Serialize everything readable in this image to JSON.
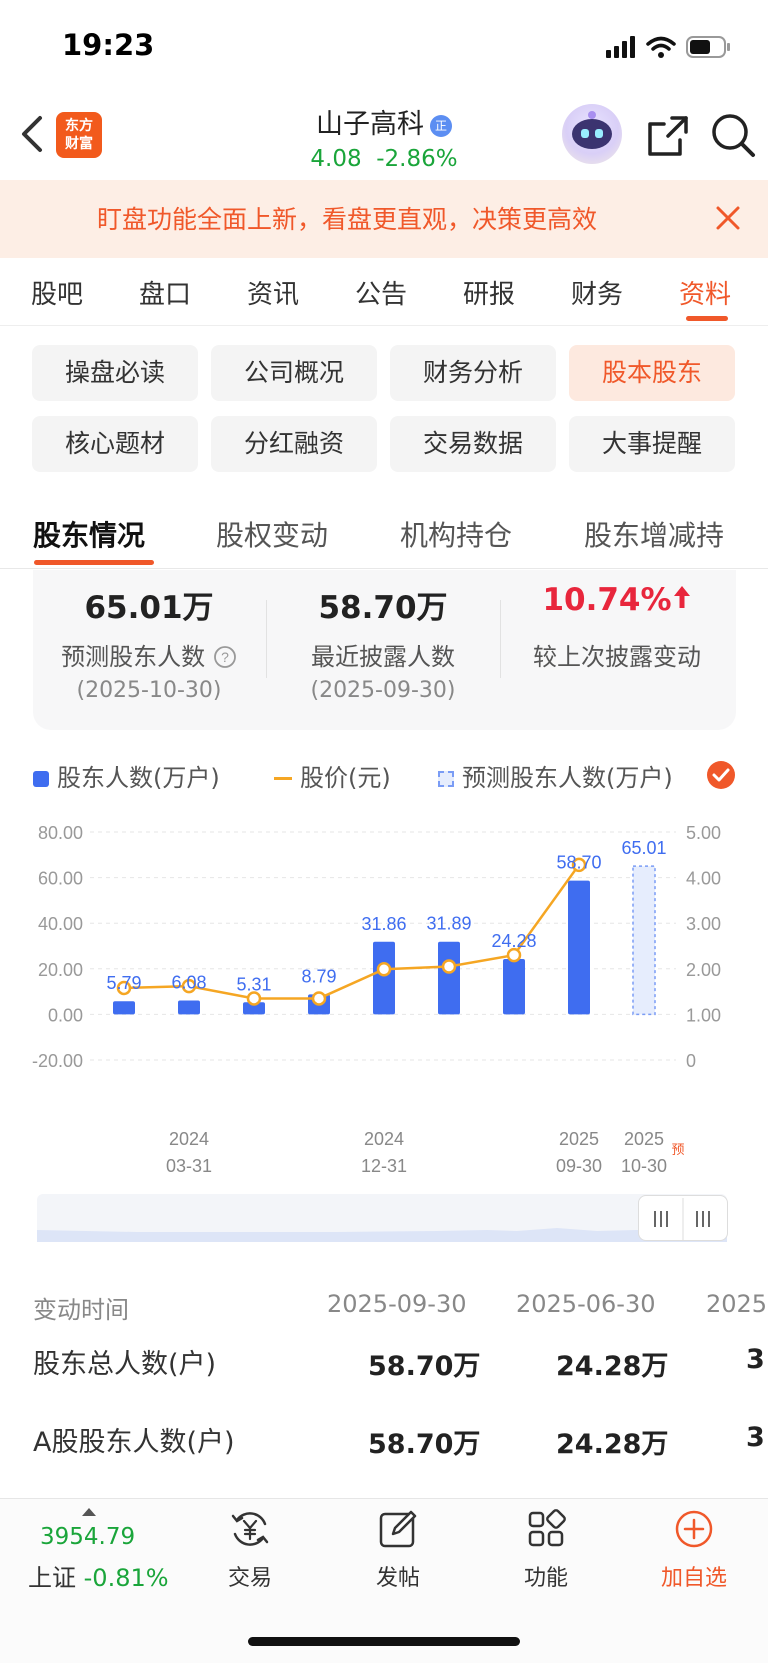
{
  "status_bar": {
    "time": "19:23"
  },
  "header": {
    "logo_line1": "东方",
    "logo_line2": "财富",
    "stock_name": "山子高科",
    "badge": "正",
    "price": "4.08",
    "change": "-2.86%"
  },
  "banner": {
    "text": "盯盘功能全面上新，看盘更直观，决策更高效"
  },
  "tabs": [
    "股吧",
    "盘口",
    "资讯",
    "公告",
    "研报",
    "财务",
    "资料"
  ],
  "sub_grid": [
    "操盘必读",
    "公司概况",
    "财务分析",
    "股本股东",
    "核心题材",
    "分红融资",
    "交易数据",
    "大事提醒"
  ],
  "section_tabs": [
    "股东情况",
    "股权变动",
    "机构持仓",
    "股东增减持"
  ],
  "stats": [
    {
      "value": "65.01万",
      "label": "预测股东人数",
      "date": "(2025-10-30)"
    },
    {
      "value": "58.70万",
      "label": "最近披露人数",
      "date": "(2025-09-30)"
    },
    {
      "value": "10.74%",
      "label": "较上次披露变动"
    }
  ],
  "legend": {
    "holders": "股东人数(万户)",
    "price": "股价(元)",
    "forecast": "预测股东人数(万户)"
  },
  "colors": {
    "accent": "#f0582a",
    "down": "#1aa53a",
    "up": "#e8263c",
    "bar": "#3f6df0",
    "line": "#f5a623"
  },
  "chart_data": {
    "type": "bar",
    "left_axis": {
      "ticks": [
        "80.00",
        "60.00",
        "40.00",
        "20.00",
        "0.00",
        "-20.00"
      ],
      "range": [
        -20,
        80
      ]
    },
    "right_axis": {
      "ticks": [
        "5.00",
        "4.00",
        "3.00",
        "2.00",
        "1.00",
        "0"
      ],
      "range": [
        0,
        5
      ]
    },
    "bars": [
      {
        "value": 5.79,
        "label": "5.79"
      },
      {
        "value": 6.08,
        "label": "6.08"
      },
      {
        "value": 5.31,
        "label": "5.31"
      },
      {
        "value": 8.79,
        "label": "8.79"
      },
      {
        "value": 31.86,
        "label": "31.86"
      },
      {
        "value": 31.89,
        "label": "31.89"
      },
      {
        "value": 24.28,
        "label": "24.28"
      },
      {
        "value": 58.7,
        "label": "58.70"
      }
    ],
    "forecast_bar": {
      "value": 65.01,
      "label": "65.01"
    },
    "price_line": [
      1.58,
      1.62,
      1.35,
      1.35,
      1.99,
      2.05,
      2.3,
      4.28
    ],
    "x_ticks": [
      {
        "year": "2024",
        "date": "03-31"
      },
      {
        "year": "2024",
        "date": "12-31"
      },
      {
        "year": "2025",
        "date": "09-30"
      },
      {
        "year": "2025",
        "date": "10-30"
      }
    ],
    "forecast_mark": "预"
  },
  "table": {
    "head_label": "变动时间",
    "head_dates": [
      "2025-09-30",
      "2025-06-30",
      "2025"
    ],
    "rows": [
      {
        "label": "股东总人数(户)",
        "values": [
          "58.70万",
          "24.28万",
          "3"
        ]
      },
      {
        "label": "A股股东人数(户)",
        "values": [
          "58.70万",
          "24.28万",
          "3"
        ]
      }
    ]
  },
  "bottom_nav": {
    "index_value": "3954.79",
    "index_name": "上证",
    "index_change": "-0.81%",
    "items": [
      "交易",
      "发帖",
      "功能",
      "加自选"
    ]
  }
}
